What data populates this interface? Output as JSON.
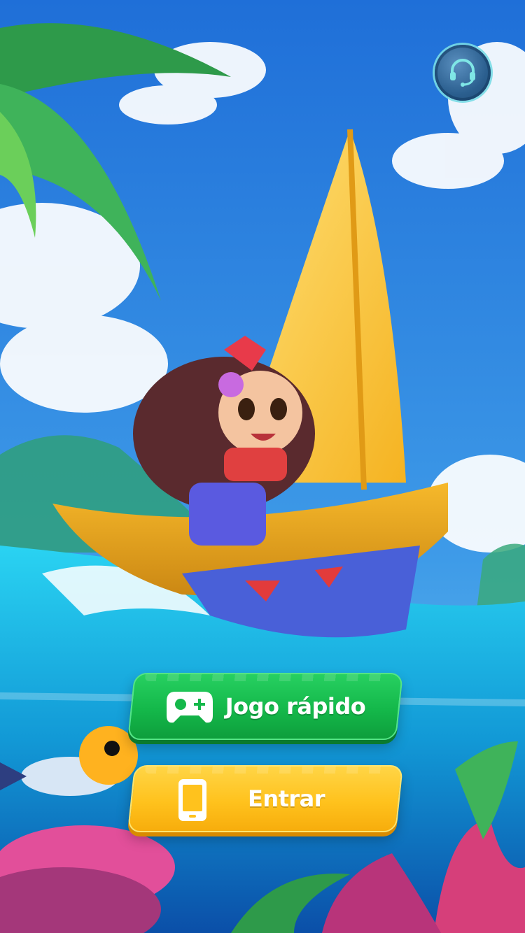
{
  "colors": {
    "quick_play": "#14b84a",
    "login": "#ffc21d",
    "sky": "#2f86e6",
    "sea": "#17b6e8"
  },
  "header": {
    "support_icon": "headset-icon"
  },
  "actions": {
    "quick_play": {
      "label": "Jogo rápido",
      "icon": "gamepad-icon"
    },
    "login": {
      "label": "Entrar",
      "icon": "phone-icon"
    }
  }
}
